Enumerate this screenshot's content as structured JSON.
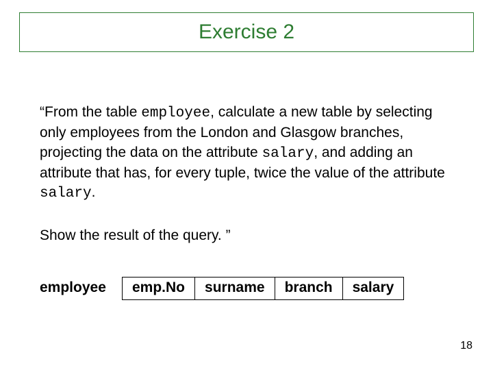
{
  "title": "Exercise 2",
  "para": {
    "lead1": "“From the table ",
    "code1": "employee",
    "mid1": ", calculate a new table by selecting only employees from the London and Glasgow branches, projecting the data on the attribute ",
    "code2": "salary",
    "mid2": ", and adding an attribute that has, for every tuple, twice the value of the attribute ",
    "code3": "salary",
    "tail": "."
  },
  "show_line": "Show the result of the query. ”",
  "table_label": "employee",
  "columns": [
    "emp.No",
    "surname",
    "branch",
    "salary"
  ],
  "page_number": "18"
}
